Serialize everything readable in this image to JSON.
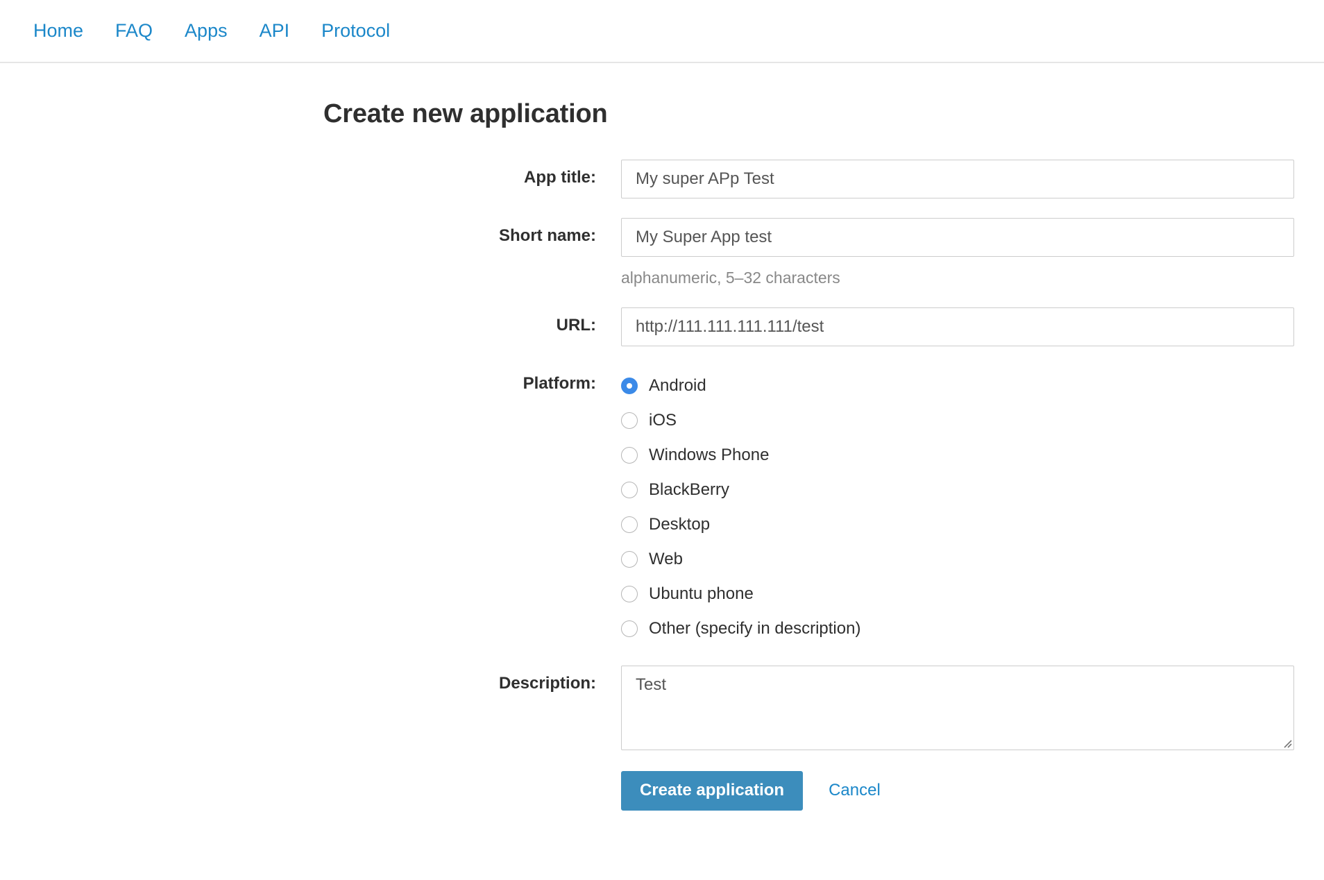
{
  "nav": {
    "items": [
      {
        "label": "Home"
      },
      {
        "label": "FAQ"
      },
      {
        "label": "Apps"
      },
      {
        "label": "API"
      },
      {
        "label": "Protocol"
      }
    ]
  },
  "page": {
    "title": "Create new application"
  },
  "form": {
    "app_title": {
      "label": "App title:",
      "value": "My super APp Test",
      "placeholder": ""
    },
    "short_name": {
      "label": "Short name:",
      "value": "My Super App test",
      "placeholder": "",
      "help": "alphanumeric, 5–32 characters"
    },
    "url": {
      "label": "URL:",
      "value": "http://111.111.111.111/test",
      "placeholder": ""
    },
    "platform": {
      "label": "Platform:",
      "selected": "Android",
      "options": [
        {
          "label": "Android",
          "checked": true
        },
        {
          "label": "iOS",
          "checked": false
        },
        {
          "label": "Windows Phone",
          "checked": false
        },
        {
          "label": "BlackBerry",
          "checked": false
        },
        {
          "label": "Desktop",
          "checked": false
        },
        {
          "label": "Web",
          "checked": false
        },
        {
          "label": "Ubuntu phone",
          "checked": false
        },
        {
          "label": "Other (specify in description)",
          "checked": false
        }
      ]
    },
    "description": {
      "label": "Description:",
      "value": "Test",
      "placeholder": ""
    }
  },
  "actions": {
    "submit_label": "Create application",
    "cancel_label": "Cancel"
  },
  "colors": {
    "link": "#1b87c9",
    "primary_button": "#3c8dbc",
    "radio_selected": "#3b8ae8",
    "border": "#cccccc",
    "help_text": "#888888"
  }
}
